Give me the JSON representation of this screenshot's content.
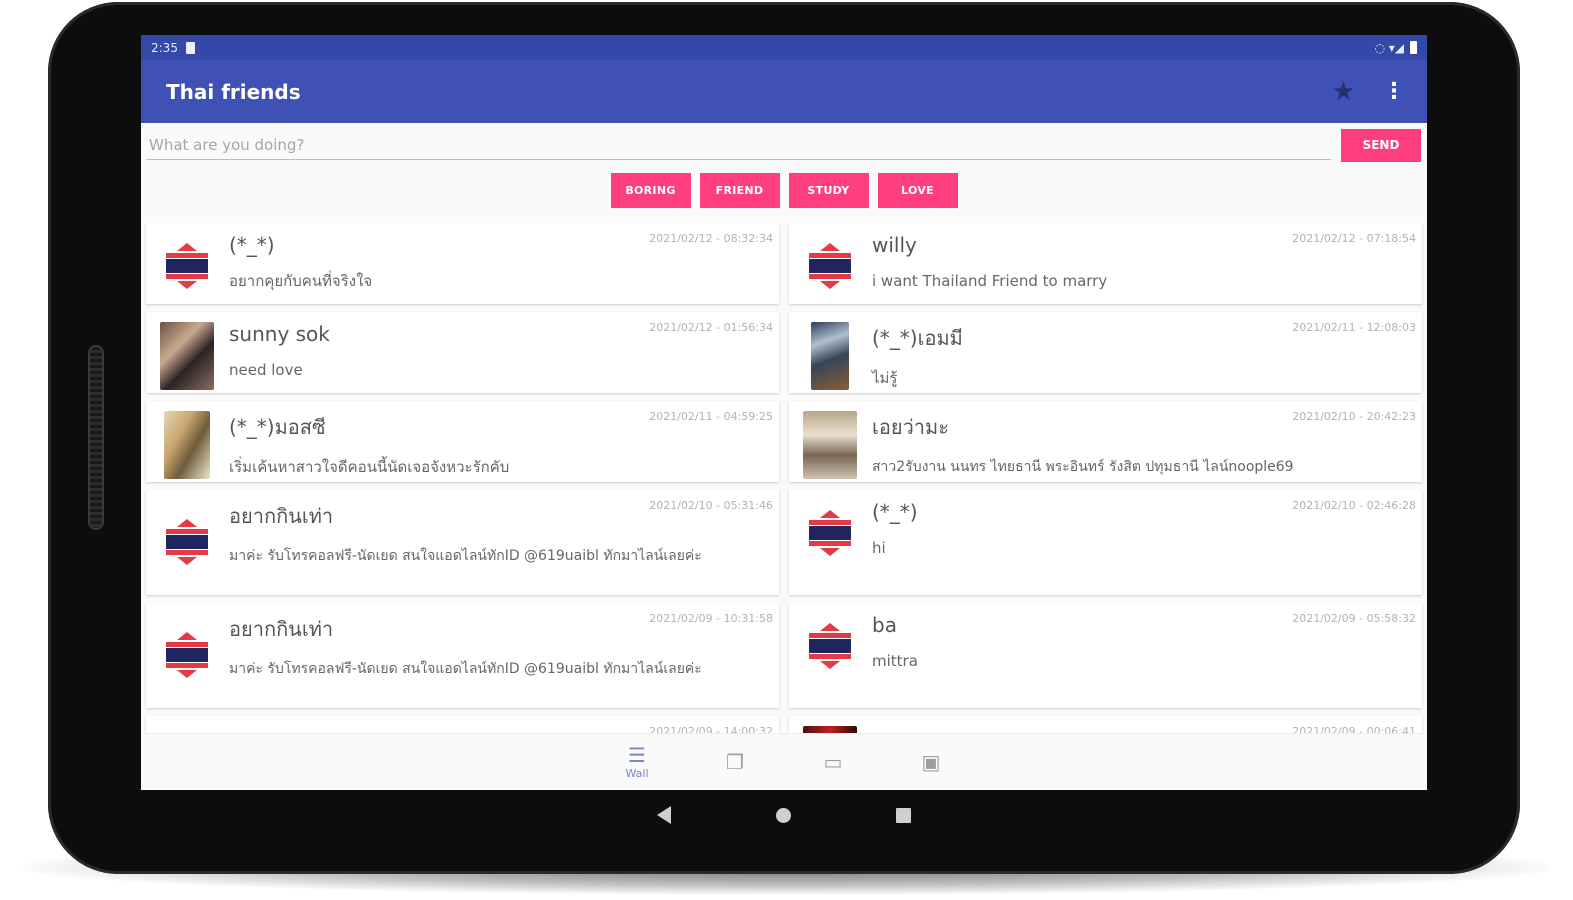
{
  "status_bar": {
    "time": "2:35",
    "right_indicators": "◌ ▾◢"
  },
  "toolbar": {
    "title": "Thai friends",
    "star_icon": "star-icon",
    "more_icon": "more-vert-icon"
  },
  "composer": {
    "placeholder": "What are you doing?",
    "value": "",
    "send_label": "SEND"
  },
  "topics": [
    "BORING",
    "FRIEND",
    "STUDY",
    "LOVE"
  ],
  "posts": [
    {
      "name": "(*_*)",
      "message": "อยากคุยกับคนที่จริงใจ",
      "time": "2021/02/12 - 08:32:34",
      "avatar": "flag"
    },
    {
      "name": "willy",
      "message": "i want Thailand Friend to marry",
      "time": "2021/02/12 - 07:18:54",
      "avatar": "flag"
    },
    {
      "name": "sunny sok",
      "message": "need love",
      "time": "2021/02/12 - 01:56:34",
      "avatar": "photo"
    },
    {
      "name": "(*_*)เอมมี",
      "message": "ไม่รู้",
      "time": "2021/02/11 - 12:08:03",
      "avatar": "photo"
    },
    {
      "name": "(*_*)มอสซี",
      "message": "เริ่มเค้นหาสาวใจดีคอนนี้นัดเจอจังหวะรักคับ",
      "time": "2021/02/11 - 04:59:25",
      "avatar": "photo"
    },
    {
      "name": "เอยว่ามะ",
      "message": "สาว2รับงาน นนทร ไทยธานี พระอินทร์ รังสิต ปทุมธานี ไลน์noople69",
      "time": "2021/02/10 - 20:42:23",
      "avatar": "photo"
    },
    {
      "name": "อยากกินเท่า",
      "message": "มาค่ะ รับโทรคอลฟรี-นัดเยด สนใจแอดไลน์ทักID @619uaibl ทักมาไลน์เลยค่ะ",
      "time": "2021/02/10 - 05:31:46",
      "avatar": "flag"
    },
    {
      "name": "(*_*)",
      "message": "hi",
      "time": "2021/02/10 - 02:46:28",
      "avatar": "flag"
    },
    {
      "name": "อยากกินเท่า",
      "message": "มาค่ะ รับโทรคอลฟรี-นัดเยด สนใจแอดไลน์ทักID @619uaibl ทักมาไลน์เลยค่ะ",
      "time": "2021/02/09 - 10:31:58",
      "avatar": "flag"
    },
    {
      "name": "ba",
      "message": "mittra",
      "time": "2021/02/09 - 05:58:32",
      "avatar": "flag"
    },
    {
      "name": "...",
      "message": "",
      "time": "2021/02/09 - 14:00:32",
      "avatar": "flag"
    },
    {
      "name": "...",
      "message": "",
      "time": "2021/02/09 - 00:06:41",
      "avatar": "photo"
    }
  ],
  "bottom_nav": [
    {
      "label": "Wall",
      "icon": "wall-icon",
      "active": true
    },
    {
      "label": "",
      "icon": "chat-icon",
      "active": false
    },
    {
      "label": "",
      "icon": "message-icon",
      "active": false
    },
    {
      "label": "",
      "icon": "contacts-icon",
      "active": false
    }
  ],
  "colors": {
    "primary": "#3f51b5",
    "primary_dark": "#3448a8",
    "accent": "#ff3d81"
  }
}
